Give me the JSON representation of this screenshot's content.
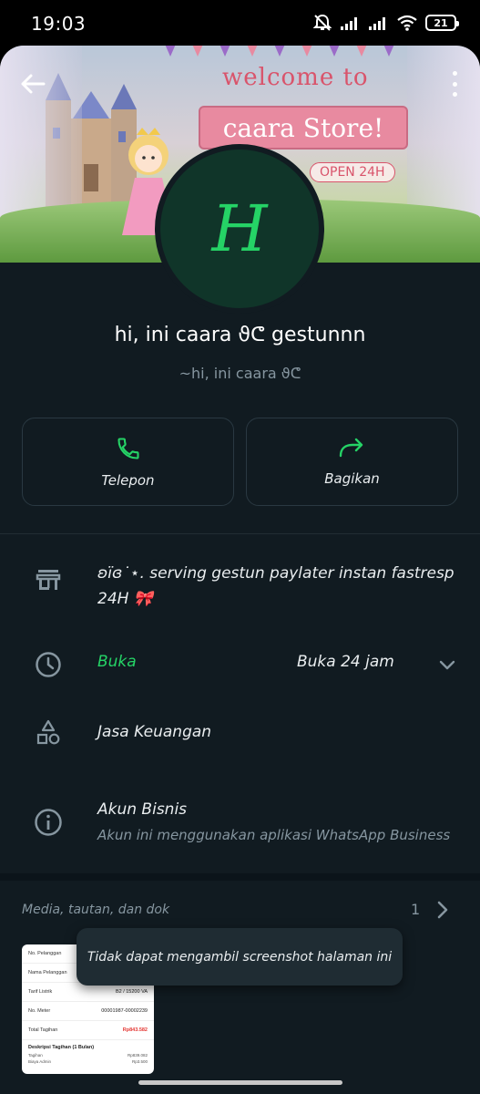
{
  "status_bar": {
    "time": "19:03",
    "battery": "21",
    "icons": [
      "mute-icon",
      "signal-icon",
      "signal-icon",
      "wifi-icon",
      "battery-icon"
    ]
  },
  "cover": {
    "welcome": "welcome to",
    "store": "caara Store!",
    "open": "OPEN 24H"
  },
  "profile": {
    "avatar_letter": "H",
    "name": "hi, ini caara ϑᕦ gestunnn",
    "subtitle": "~hi, ini caara ϑᕦ"
  },
  "actions": {
    "call_label": "Telepon",
    "share_label": "Bagikan"
  },
  "business": {
    "description": "ʚïɞ˙⋆. serving gestun paylater instan fastresp 24H 🎀",
    "open_status": "Buka",
    "hours": "Buka 24 jam",
    "category": "Jasa Keuangan",
    "account_title": "Akun Bisnis",
    "account_sub": "Akun ini menggunakan aplikasi WhatsApp Business"
  },
  "media": {
    "title": "Media, tautan, dan dok",
    "count": "1",
    "doc": {
      "rows": [
        {
          "label": "No. Pelanggan",
          "value": ""
        },
        {
          "label": "Nama Pelanggan",
          "value": ""
        },
        {
          "label": "Tarif Listrik",
          "value": "B2 / 15200 VA"
        },
        {
          "label": "No. Meter",
          "value": "00001987-00002239"
        },
        {
          "label": "Total Tagihan",
          "value": "Rp843.582"
        }
      ],
      "section": "Deskripsi Tagihan (1 Bulan)",
      "mini": [
        {
          "label": "Tagihan",
          "value": "Rp839.082"
        },
        {
          "label": "Biaya Admin",
          "value": "Rp3.500"
        }
      ]
    }
  },
  "toast": {
    "message": "Tidak dapat mengambil screenshot halaman ini"
  },
  "colors": {
    "background": "#111b21",
    "accent": "#25d366",
    "muted": "#8696a0",
    "avatar_bg": "#103529"
  }
}
